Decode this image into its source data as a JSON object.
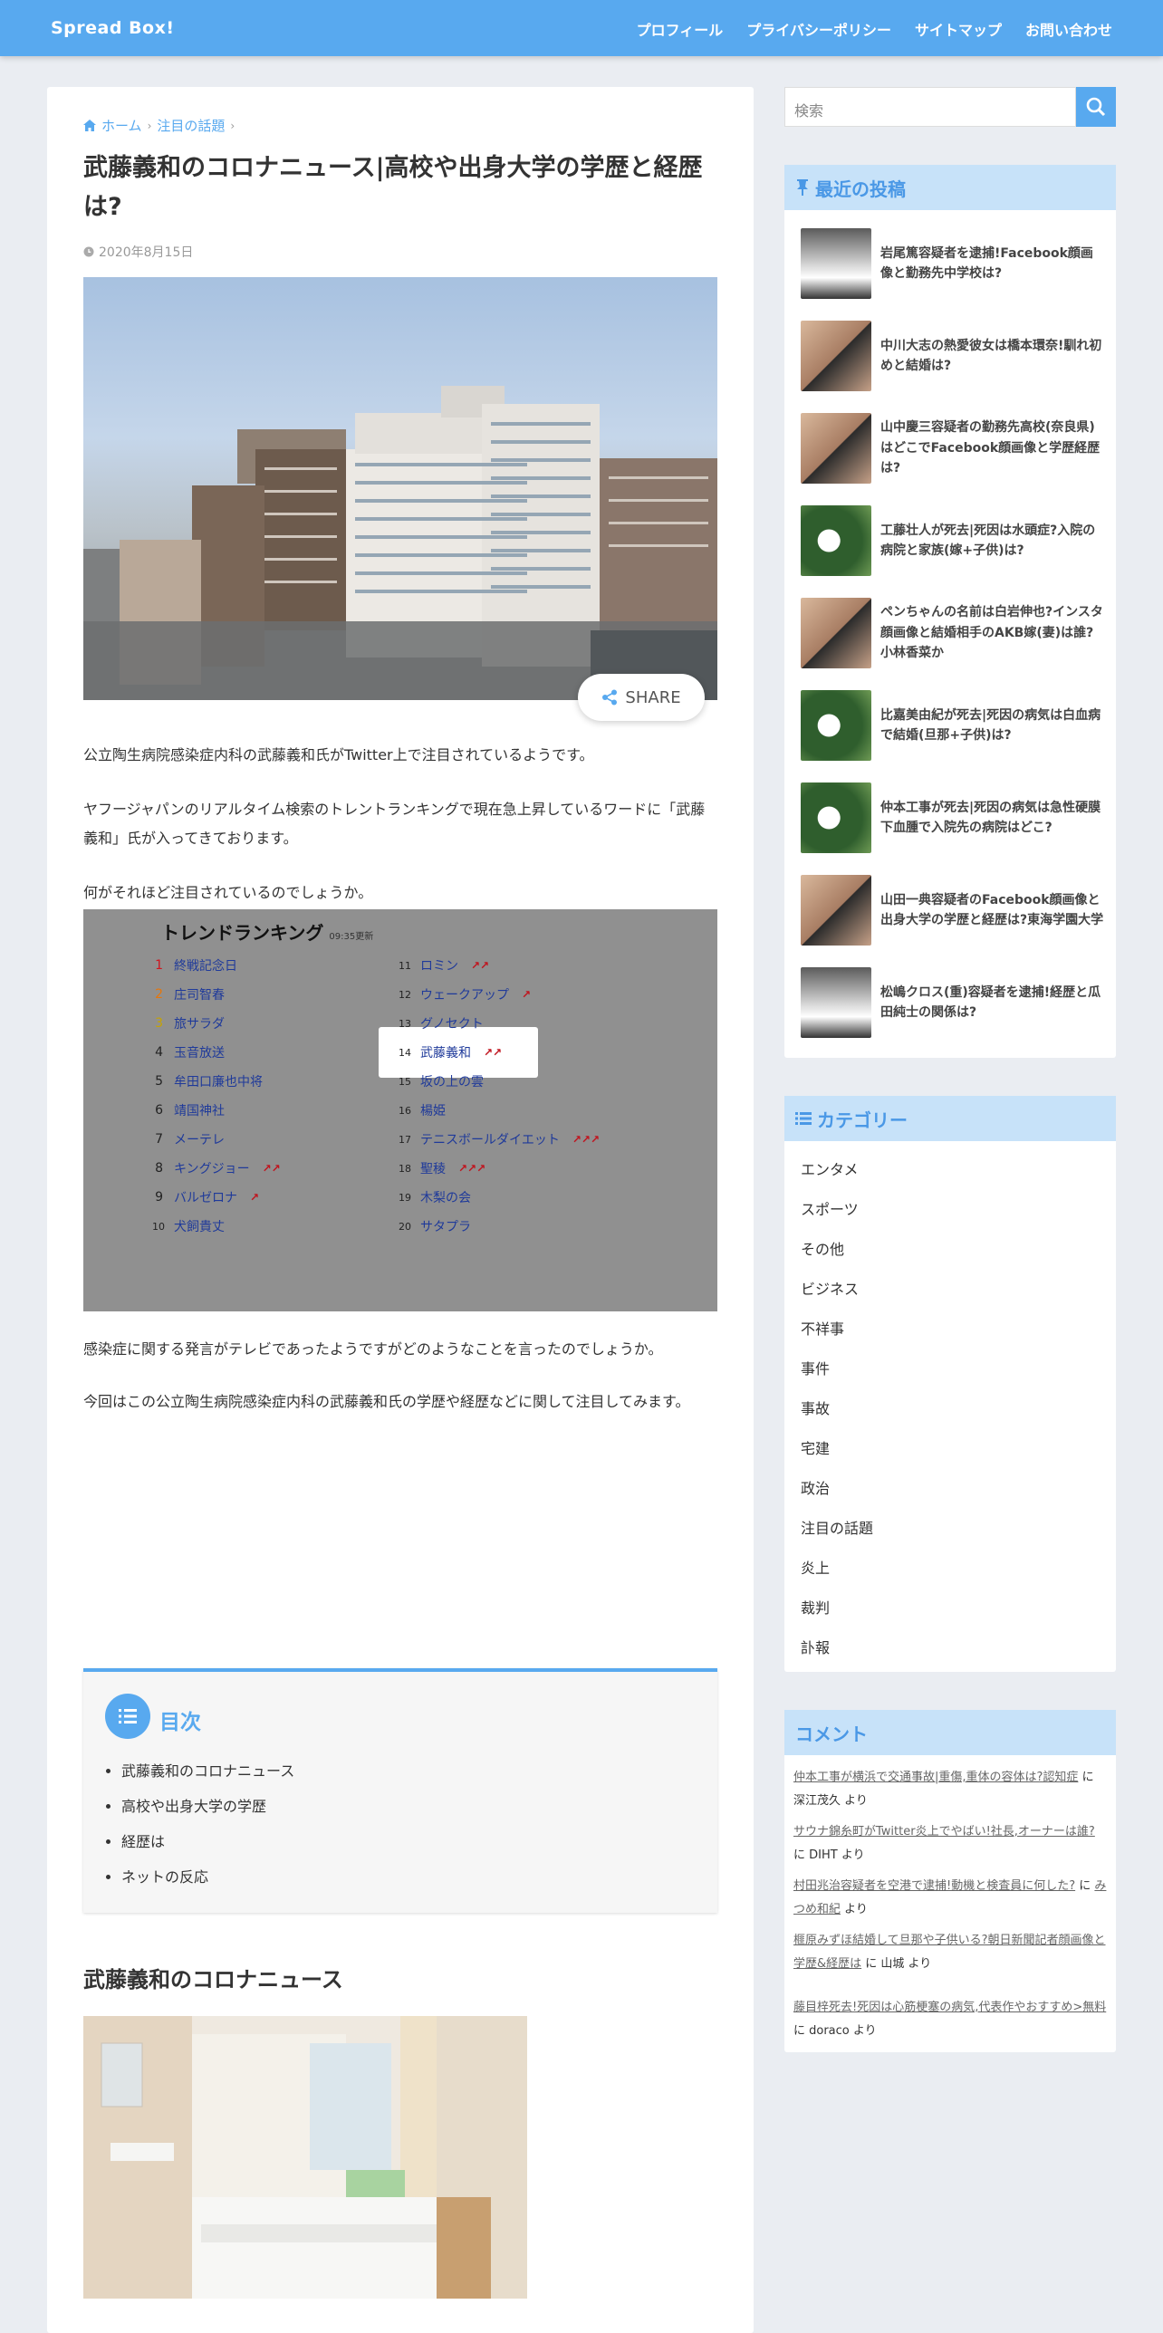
{
  "header": {
    "logo": "Spread Box!",
    "nav": [
      "プロフィール",
      "プライバシーポリシー",
      "サイトマップ",
      "お問い合わせ"
    ]
  },
  "breadcrumb": {
    "home": "ホーム",
    "category": "注目の話題"
  },
  "article": {
    "title": "武藤義和のコロナニュース|高校や出身大学の学歴と経歴は?",
    "date": "2020年8月15日",
    "share_label": "SHARE",
    "p1": "公立陶生病院感染症内科の武藤義和氏がTwitter上で注目されているようです。",
    "p2": "ヤフージャパンのリアルタイム検索のトレントランキングで現在急上昇しているワードに「武藤義和」氏が入ってきております。",
    "p3": "何がそれほど注目されているのでしょうか。",
    "p4": "感染症に関する発言がテレビであったようですがどのようなことを言ったのでしょうか。",
    "p5": "今回はこの公立陶生病院感染症内科の武藤義和氏の学歴や経歴などに関して注目してみます。",
    "section_title": "武藤義和のコロナニュース"
  },
  "trend": {
    "title": "トレンドランキング",
    "updated": "09:35更新",
    "left": [
      {
        "n": "1",
        "w": "終戦記念日",
        "up": ""
      },
      {
        "n": "2",
        "w": "庄司智春",
        "up": ""
      },
      {
        "n": "3",
        "w": "旅サラダ",
        "up": ""
      },
      {
        "n": "4",
        "w": "玉音放送",
        "up": ""
      },
      {
        "n": "5",
        "w": "牟田口廉也中将",
        "up": ""
      },
      {
        "n": "6",
        "w": "靖国神社",
        "up": ""
      },
      {
        "n": "7",
        "w": "メーテレ",
        "up": ""
      },
      {
        "n": "8",
        "w": "キングジョー",
        "up": "↗↗"
      },
      {
        "n": "9",
        "w": "バルゼロナ",
        "up": "↗"
      },
      {
        "n": "10",
        "w": "犬飼貴丈",
        "up": ""
      }
    ],
    "right": [
      {
        "n": "11",
        "w": "ロミン",
        "up": "↗↗"
      },
      {
        "n": "12",
        "w": "ウェークアップ",
        "up": "↗"
      },
      {
        "n": "13",
        "w": "グノセクト",
        "up": ""
      },
      {
        "n": "14",
        "w": "武藤義和",
        "up": "↗↗"
      },
      {
        "n": "15",
        "w": "坂の上の雲",
        "up": ""
      },
      {
        "n": "16",
        "w": "楊姫",
        "up": ""
      },
      {
        "n": "17",
        "w": "テニスボールダイエット",
        "up": "↗↗↗"
      },
      {
        "n": "18",
        "w": "聖稜",
        "up": "↗↗↗"
      },
      {
        "n": "19",
        "w": "木梨の会",
        "up": ""
      },
      {
        "n": "20",
        "w": "サタプラ",
        "up": ""
      }
    ]
  },
  "toc": {
    "title": "目次",
    "items": [
      "武藤義和のコロナニュース",
      "高校や出身大学の学歴",
      "経歴は",
      "ネットの反応"
    ]
  },
  "sidebar": {
    "search_placeholder": "検索",
    "recent_title": "最近の投稿",
    "recent": [
      "岩尾篤容疑者を逮捕!Facebook顔画像と勤務先中学校は?",
      "中川大志の熱愛彼女は橋本環奈!馴れ初めと結婚は?",
      "山中慶三容疑者の勤務先高校(奈良県)はどこでFacebook顔画像と学歴経歴は?",
      "工藤壮人が死去|死因は水頭症?入院の病院と家族(嫁+子供)は?",
      "ペンちゃんの名前は白岩伸也?インスタ顔画像と結婚相手のAKB嫁(妻)は誰?小林香菜か",
      "比嘉美由紀が死去|死因の病気は白血病で結婚(旦那+子供)は?",
      "仲本工事が死去|死因の病気は急性硬膜下血腫で入院先の病院はどこ?",
      "山田一典容疑者のFacebook顔画像と出身大学の学歴と経歴は?東海学園大学",
      "松嶋クロス(重)容疑者を逮捕!経歴と瓜田純士の関係は?"
    ],
    "category_title": "カテゴリー",
    "categories": [
      "エンタメ",
      "スポーツ",
      "その他",
      "ビジネス",
      "不祥事",
      "事件",
      "事故",
      "宅建",
      "政治",
      "注目の話題",
      "炎上",
      "裁判",
      "訃報"
    ],
    "comment_title": "コメント",
    "comments": [
      {
        "link": "仲本工事が横浜で交通事故|重傷,重体の容体は?認知症",
        "by": "に 深江茂久 より"
      },
      {
        "link": "サウナ錦糸町がTwitter炎上でやばい!社長,オーナーは誰?",
        "by": "に DIHT より"
      },
      {
        "link": "村田兆治容疑者を空港で逮捕!動機と検査員に何した?",
        "by": "に ",
        "by_link": "みつめ和紀",
        "by_end": " より"
      },
      {
        "link": "榧原みずほ結婚して旦那や子供いる?朝日新聞記者顔画像と学歴&経歴は",
        "by": "に 山城 より"
      },
      {
        "link": "藤目梓死去!死因は心筋梗塞の病気,代表作やおすすめ>無料",
        "by": "に doraco より"
      }
    ]
  }
}
